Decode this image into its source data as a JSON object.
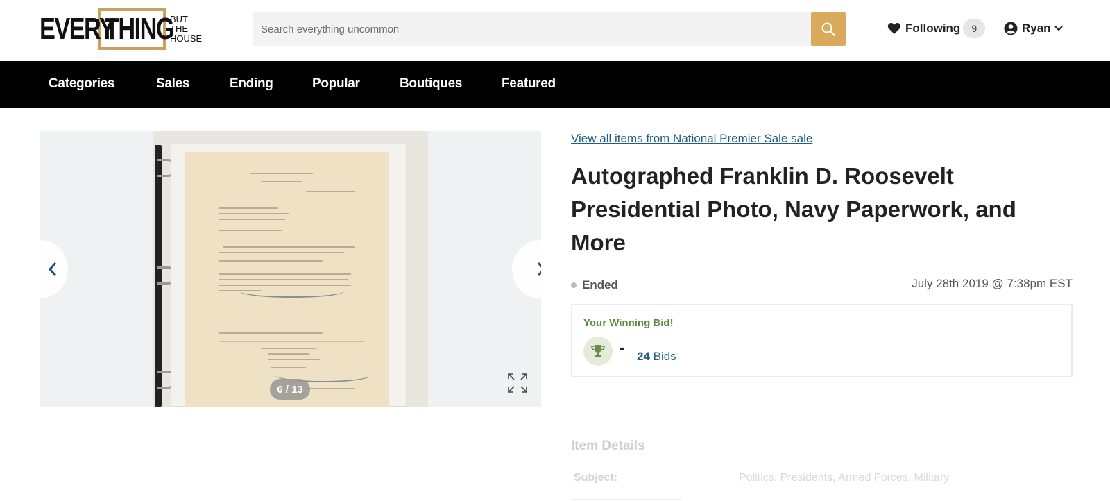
{
  "header": {
    "logo": {
      "every": "EVERY",
      "thing": "THING",
      "small": [
        "BUT",
        "THE",
        "HOUSE"
      ]
    },
    "search": {
      "placeholder": "Search everything uncommon",
      "icon": "search-icon"
    },
    "following": {
      "label": "Following",
      "count": "9",
      "icon": "heart-icon"
    },
    "account": {
      "name": "Ryan",
      "icon": "user-circle-icon",
      "caret": "chevron-down-icon"
    }
  },
  "nav": {
    "items": [
      "Categories",
      "Sales",
      "Ending",
      "Popular",
      "Boutiques",
      "Featured"
    ]
  },
  "gallery": {
    "counter": "6 / 13",
    "prev_icon": "chevron-left-icon",
    "next_icon": "chevron-right-icon",
    "expand_icon": "expand-icon"
  },
  "item": {
    "sale_link": "View all items from National Premier Sale sale",
    "title": "Autographed Franklin D. Roosevelt Presidential Photo, Navy Paperwork, and More",
    "status": "Ended",
    "end_date": "July 28th 2019 @ 7:38pm EST",
    "bid": {
      "heading": "Your Winning Bid!",
      "amount": "-",
      "count_number": "24",
      "count_label": "Bids",
      "icon": "trophy-icon"
    },
    "details_heading": "Item Details",
    "details": [
      {
        "key": "Subject:",
        "value": "Politics, Presidents, Armed Forces, Military"
      }
    ]
  },
  "colors": {
    "accent_gold": "#d9a95c",
    "nav_bg": "#000000",
    "link_blue": "#1e5e7e",
    "winning_green": "#5a8a3a"
  }
}
